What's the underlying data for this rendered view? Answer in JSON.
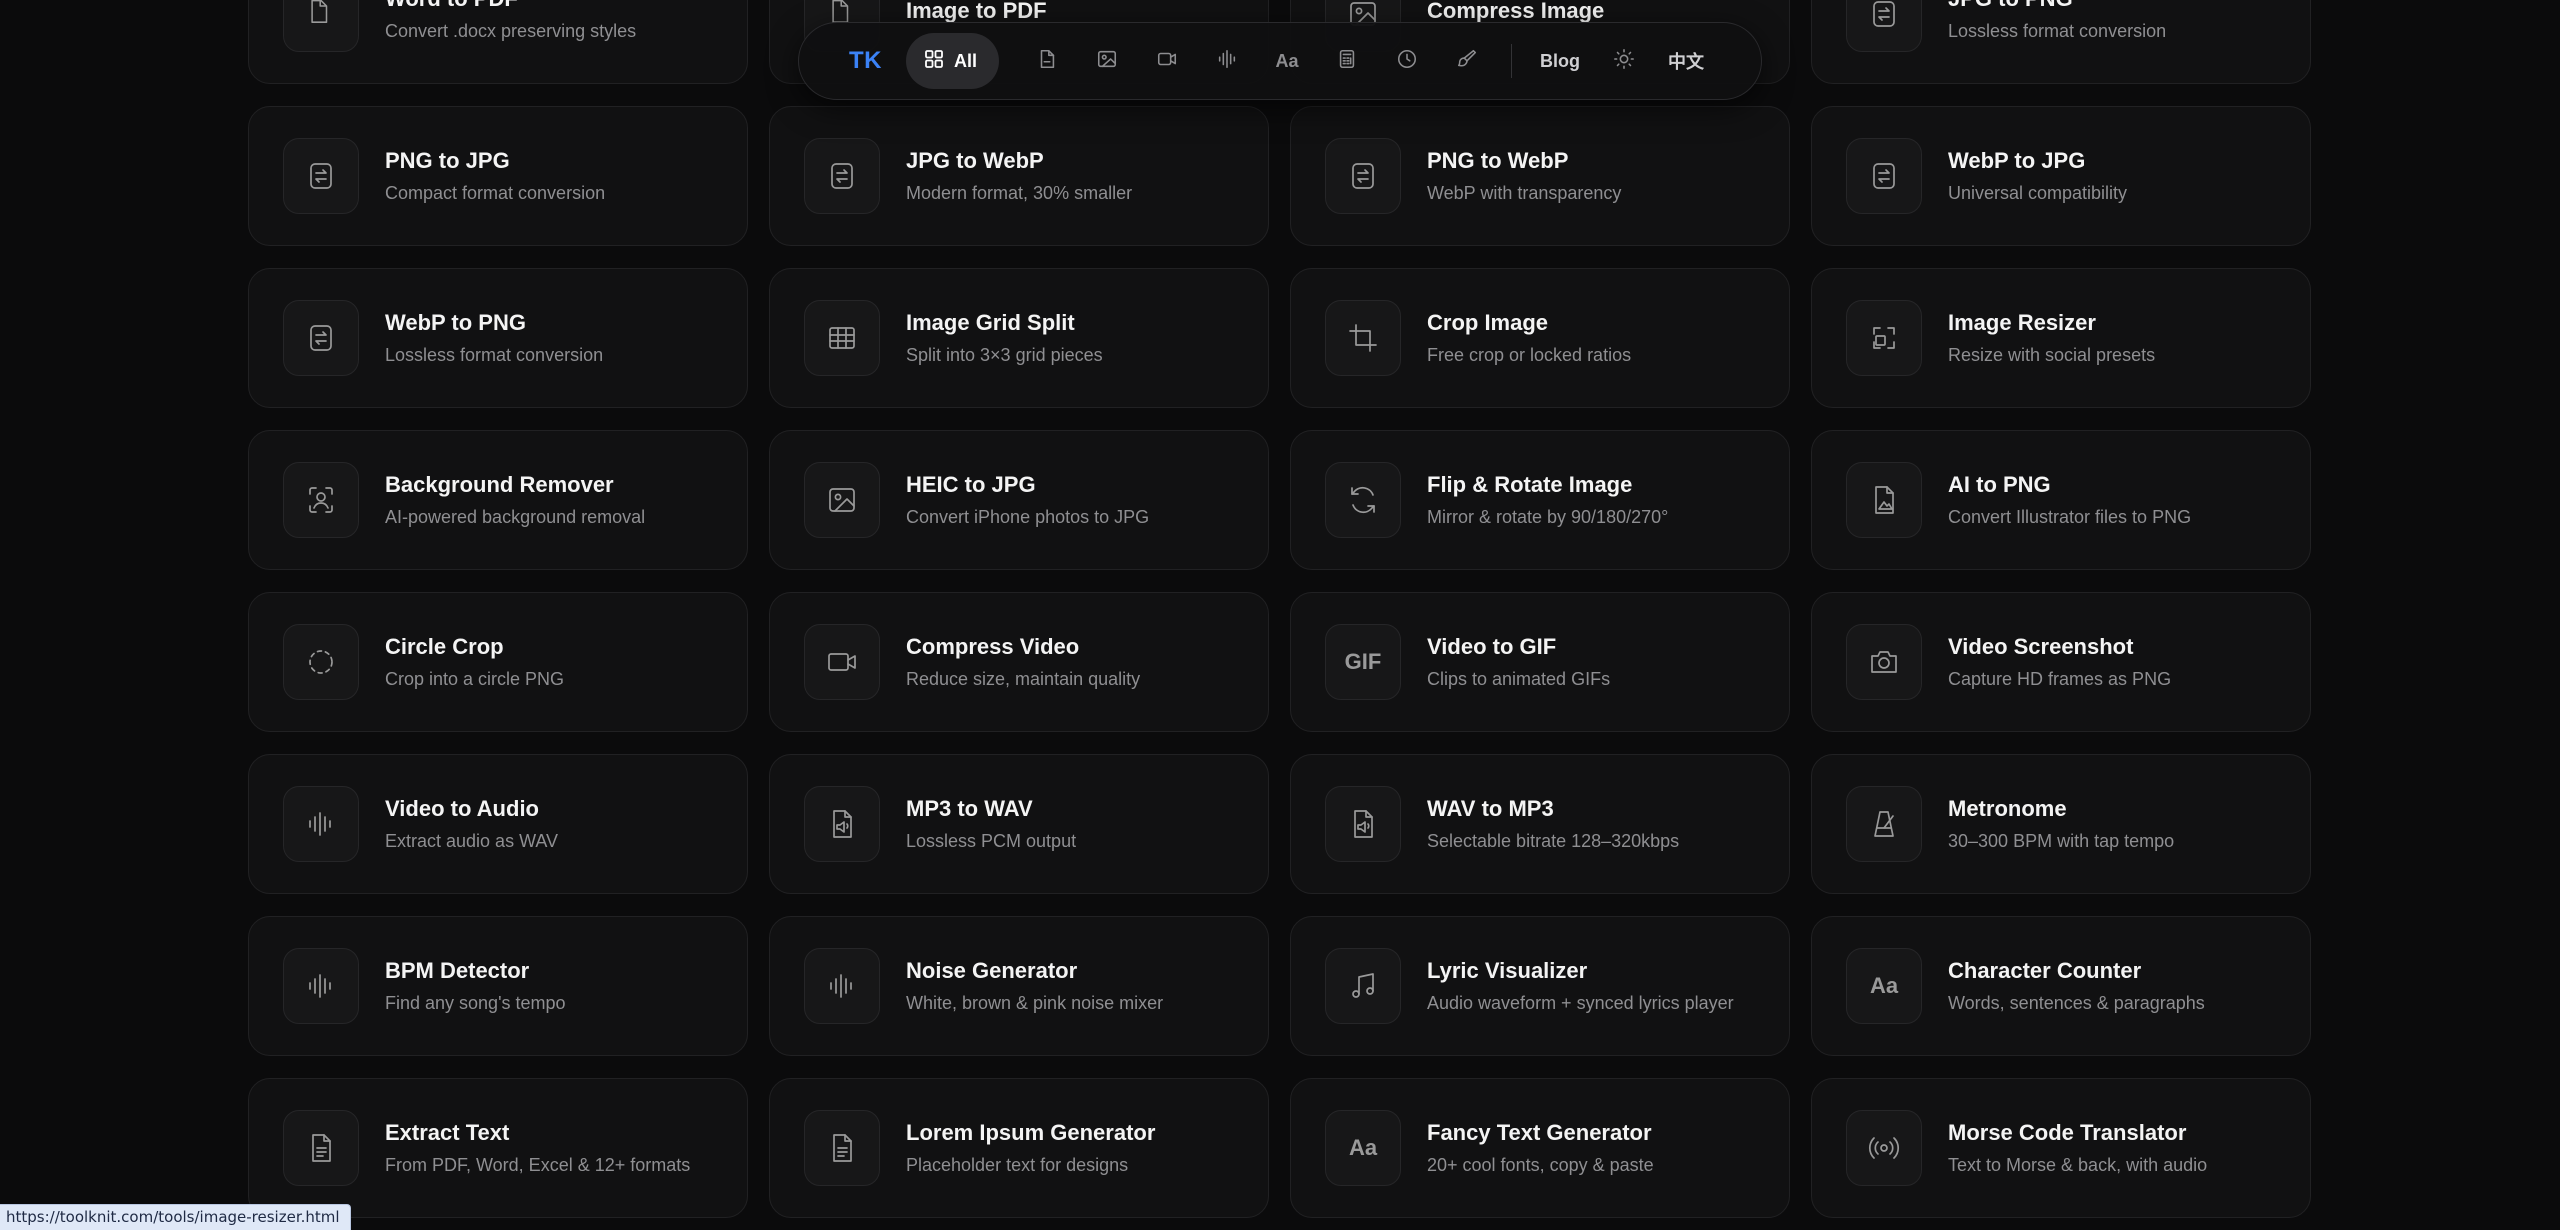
{
  "toolbar": {
    "logo": "TK",
    "all_label": "All",
    "icons": [
      "pdf-icon",
      "image-icon",
      "video-icon",
      "audio-icon",
      "text-icon",
      "calculator-icon",
      "clock-icon",
      "brush-icon"
    ],
    "text_icon_glyph": "Aa",
    "blog_label": "Blog",
    "theme_icon": "sun-icon",
    "lang_label": "中文"
  },
  "cards": [
    {
      "title": "Word to PDF",
      "desc": "Convert .docx preserving styles",
      "icon": "pdf-doc-icon"
    },
    {
      "title": "Image to PDF",
      "desc": "",
      "icon": "pdf-doc-icon"
    },
    {
      "title": "Compress Image",
      "desc": "",
      "icon": "image-icon"
    },
    {
      "title": "JPG to PNG",
      "desc": "Lossless format conversion",
      "icon": "convert-icon"
    },
    {
      "title": "PNG to JPG",
      "desc": "Compact format conversion",
      "icon": "convert-icon"
    },
    {
      "title": "JPG to WebP",
      "desc": "Modern format, 30% smaller",
      "icon": "convert-icon"
    },
    {
      "title": "PNG to WebP",
      "desc": "WebP with transparency",
      "icon": "convert-icon"
    },
    {
      "title": "WebP to JPG",
      "desc": "Universal compatibility",
      "icon": "convert-icon"
    },
    {
      "title": "WebP to PNG",
      "desc": "Lossless format conversion",
      "icon": "convert-icon"
    },
    {
      "title": "Image Grid Split",
      "desc": "Split into 3×3 grid pieces",
      "icon": "grid-icon"
    },
    {
      "title": "Crop Image",
      "desc": "Free crop or locked ratios",
      "icon": "crop-icon"
    },
    {
      "title": "Image Resizer",
      "desc": "Resize with social presets",
      "icon": "resize-icon"
    },
    {
      "title": "Background Remover",
      "desc": "AI-powered background removal",
      "icon": "person-scan-icon"
    },
    {
      "title": "HEIC to JPG",
      "desc": "Convert iPhone photos to JPG",
      "icon": "image-icon"
    },
    {
      "title": "Flip & Rotate Image",
      "desc": "Mirror & rotate by 90/180/270°",
      "icon": "rotate-icon"
    },
    {
      "title": "AI to PNG",
      "desc": "Convert Illustrator files to PNG",
      "icon": "file-image-icon"
    },
    {
      "title": "Circle Crop",
      "desc": "Crop into a circle PNG",
      "icon": "dashed-circle-icon"
    },
    {
      "title": "Compress Video",
      "desc": "Reduce size, maintain quality",
      "icon": "video-icon"
    },
    {
      "title": "Video to GIF",
      "desc": "Clips to animated GIFs",
      "icon": "gif-icon",
      "glyph": "GIF"
    },
    {
      "title": "Video Screenshot",
      "desc": "Capture HD frames as PNG",
      "icon": "camera-icon"
    },
    {
      "title": "Video to Audio",
      "desc": "Extract audio as WAV",
      "icon": "audio-wave-icon"
    },
    {
      "title": "MP3 to WAV",
      "desc": "Lossless PCM output",
      "icon": "file-audio-icon"
    },
    {
      "title": "WAV to MP3",
      "desc": "Selectable bitrate 128–320kbps",
      "icon": "file-audio-icon"
    },
    {
      "title": "Metronome",
      "desc": "30–300 BPM with tap tempo",
      "icon": "metronome-icon"
    },
    {
      "title": "BPM Detector",
      "desc": "Find any song's tempo",
      "icon": "audio-wave-icon"
    },
    {
      "title": "Noise Generator",
      "desc": "White, brown & pink noise mixer",
      "icon": "audio-wave-icon"
    },
    {
      "title": "Lyric Visualizer",
      "desc": "Audio waveform + synced lyrics player",
      "icon": "music-note-icon"
    },
    {
      "title": "Character Counter",
      "desc": "Words, sentences & paragraphs",
      "icon": "text-icon",
      "glyph": "Aa"
    },
    {
      "title": "Extract Text",
      "desc": "From PDF, Word, Excel & 12+ formats",
      "icon": "file-text-icon"
    },
    {
      "title": "Lorem Ipsum Generator",
      "desc": "Placeholder text for designs",
      "icon": "file-text-icon"
    },
    {
      "title": "Fancy Text Generator",
      "desc": "20+ cool fonts, copy & paste",
      "icon": "text-icon",
      "glyph": "Aa"
    },
    {
      "title": "Morse Code Translator",
      "desc": "Text to Morse & back, with audio",
      "icon": "broadcast-icon"
    }
  ],
  "status_bar": {
    "url": "https://toolknit.com/tools/image-resizer.html"
  }
}
